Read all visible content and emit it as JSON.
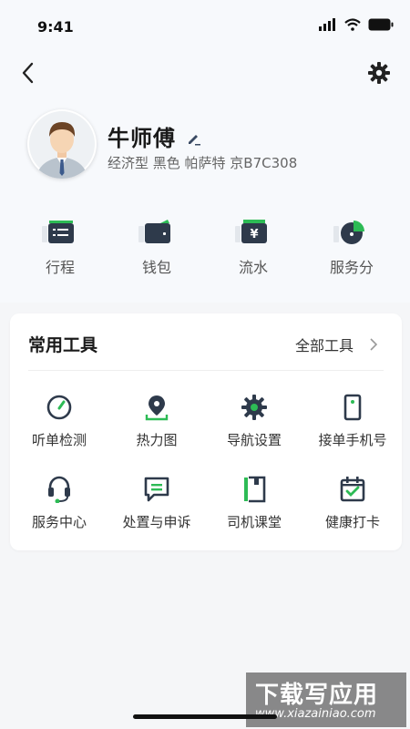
{
  "status": {
    "time": "9:41"
  },
  "profile": {
    "name": "牛师傅",
    "car_info": "经济型 黑色 帕萨特 京B7C308"
  },
  "quick_actions": [
    {
      "label": "行程",
      "icon": "itinerary-icon"
    },
    {
      "label": "钱包",
      "icon": "wallet-icon"
    },
    {
      "label": "流水",
      "icon": "income-icon"
    },
    {
      "label": "服务分",
      "icon": "service-score-icon"
    }
  ],
  "tools": {
    "title": "常用工具",
    "all_label": "全部工具",
    "items": [
      {
        "label": "听单检测",
        "icon": "gauge-icon"
      },
      {
        "label": "热力图",
        "icon": "map-pin-icon"
      },
      {
        "label": "导航设置",
        "icon": "gear-icon"
      },
      {
        "label": "接单手机号",
        "icon": "phone-icon"
      },
      {
        "label": "服务中心",
        "icon": "headset-icon"
      },
      {
        "label": "处置与申诉",
        "icon": "message-icon"
      },
      {
        "label": "司机课堂",
        "icon": "book-icon"
      },
      {
        "label": "健康打卡",
        "icon": "calendar-check-icon"
      }
    ]
  },
  "watermark": {
    "line1": "下载写应用",
    "line2": "www.xiazainiao.com"
  },
  "colors": {
    "accent": "#2dbb55",
    "icon": "#2e3a4b"
  }
}
